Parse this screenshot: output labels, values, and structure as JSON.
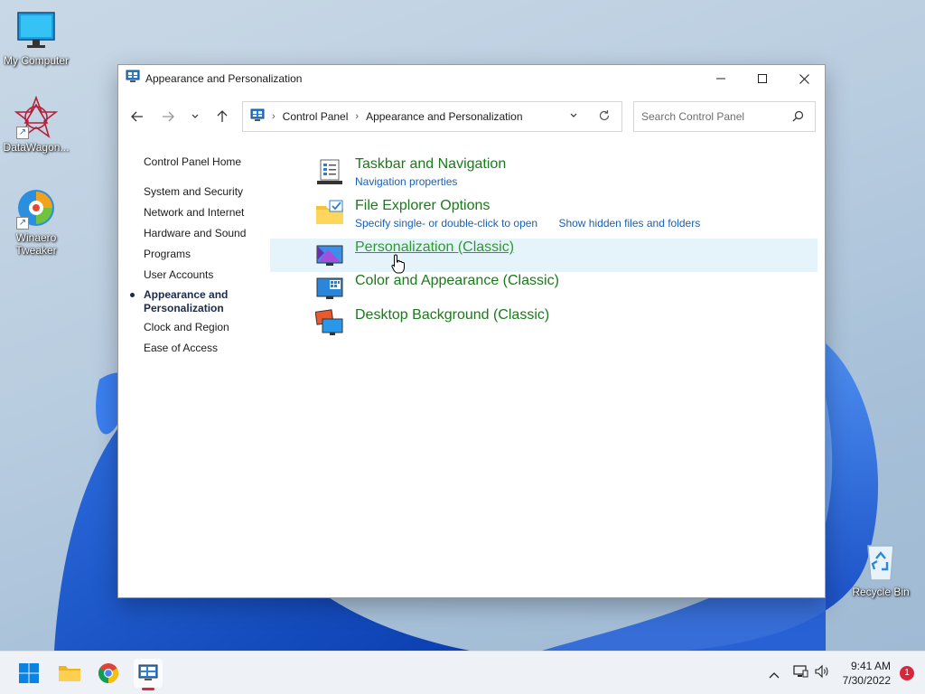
{
  "desktop": {
    "icons": [
      {
        "label": "My Computer",
        "icon": "monitor-icon"
      },
      {
        "label": "DataWagon...",
        "icon": "datawagon-icon"
      },
      {
        "label": "Winaero Tweaker",
        "icon": "winaero-tweaker-icon"
      },
      {
        "label": "Recycle Bin",
        "icon": "recycle-bin-icon"
      }
    ]
  },
  "window": {
    "title": "Appearance and Personalization",
    "breadcrumb": [
      "Control Panel",
      "Appearance and Personalization"
    ],
    "search_placeholder": "Search Control Panel"
  },
  "leftpane": {
    "home": "Control Panel Home",
    "items": [
      "System and Security",
      "Network and Internet",
      "Hardware and Sound",
      "Programs",
      "User Accounts"
    ],
    "active": "Appearance and Personalization",
    "after_items": [
      "Clock and Region",
      "Ease of Access"
    ]
  },
  "categories": [
    {
      "heading": "Taskbar and Navigation",
      "links": [
        "Navigation properties"
      ],
      "icon": "taskbar-navigation-icon"
    },
    {
      "heading": "File Explorer Options",
      "links": [
        "Specify single- or double-click to open",
        "Show hidden files and folders"
      ],
      "icon": "folder-options-icon"
    },
    {
      "heading": "Personalization (Classic)",
      "links": [],
      "icon": "personalization-icon"
    },
    {
      "heading": "Color and Appearance (Classic)",
      "links": [],
      "icon": "color-appearance-icon"
    },
    {
      "heading": "Desktop Background (Classic)",
      "links": [],
      "icon": "desktop-background-icon"
    }
  ],
  "taskbar": {
    "pinned": [
      "start-icon",
      "file-explorer-icon",
      "chrome-icon",
      "control-panel-icon"
    ],
    "time": "9:41 AM",
    "date": "7/30/2022",
    "notification_count": "1"
  },
  "colors": {
    "heading_green": "#1a7a1a",
    "link_blue": "#1a5fb4",
    "hover_bg": "#e5f3fb",
    "badge_red": "#d8263a"
  }
}
